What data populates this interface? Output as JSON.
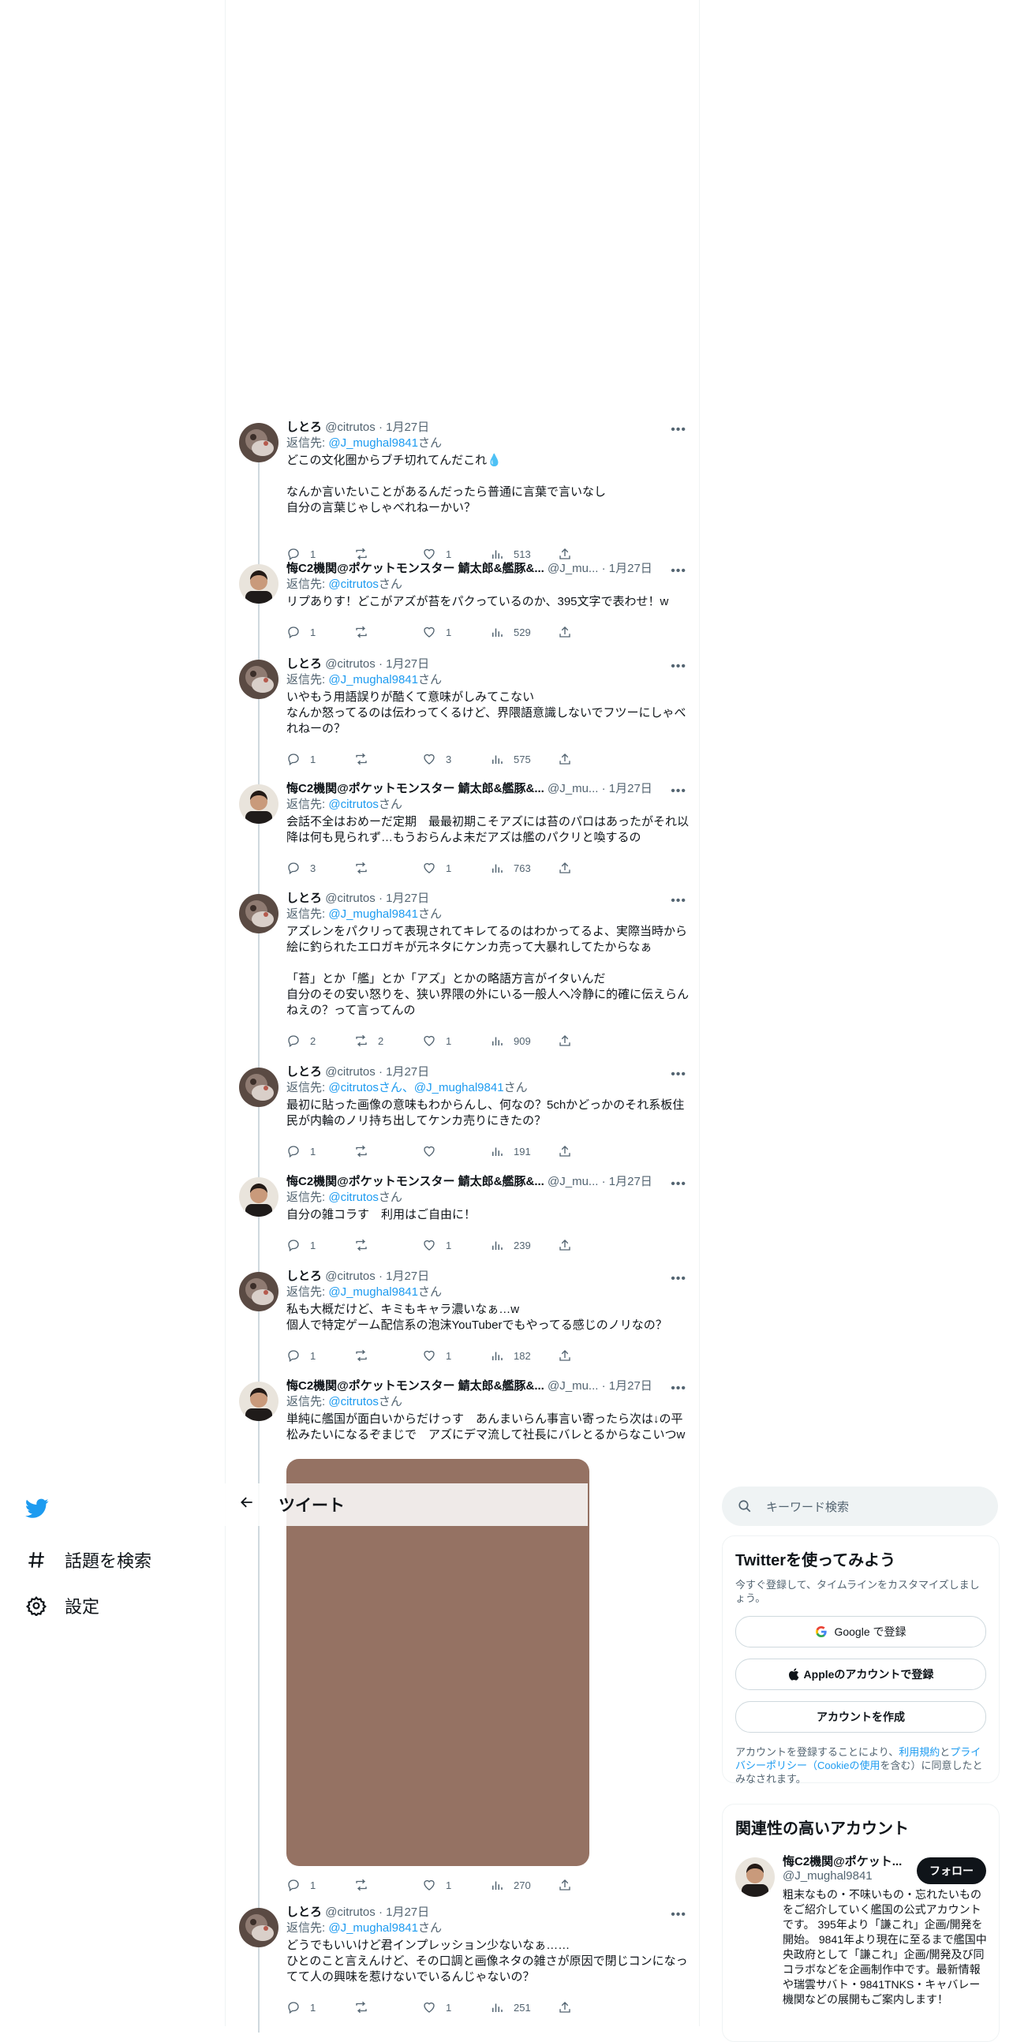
{
  "nav": {
    "explore_label": "話題を検索",
    "settings_label": "設定"
  },
  "header": {
    "title": "ツイート"
  },
  "search": {
    "placeholder": "キーワード検索"
  },
  "signup": {
    "title": "Twitterを使ってみよう",
    "subtitle": "今すぐ登録して、タイムラインをカスタマイズしましょう。",
    "google_label": "Google で登録",
    "apple_label": "Appleのアカウントで登録",
    "create_label": "アカウントを作成",
    "legal_prefix": "アカウントを登録することにより、",
    "terms_link": "利用規約",
    "and": "と",
    "privacy_link": "プライバシーポリシー（Cookieの使用",
    "legal_suffix": "を含む）に同意したとみなされます。"
  },
  "related": {
    "title": "関連性の高いアカウント",
    "name": "悔C2機関@ポケット...",
    "handle": "@J_mughal9841",
    "follow_label": "フォロー",
    "bio": "粗末なもの・不味いもの・忘れたいものをご紹介していく艦国の公式アカウントです。 395年より「謙これ」企画/開発を開始。 9841年より現在に至るまで艦国中央政府として「謙これ」企画/開発及び同コラボなどを企画制作中です。最新情報や瑞雲サバト・9841TNKS・キャバレー機関などの展開もご案内します！"
  },
  "icons": [
    "twitter-logo",
    "hashtag-icon",
    "gear-icon",
    "back-arrow-icon",
    "search-icon",
    "more-icon",
    "reply-icon",
    "retweet-icon",
    "like-icon",
    "views-icon",
    "share-icon",
    "google-icon",
    "apple-icon"
  ],
  "colors": {
    "accent": "#1d9bf0",
    "muted": "#536471",
    "image_placeholder": "#957263"
  },
  "tweets": [
    {
      "name": "しとろ",
      "handle": "@citrutos",
      "date": "1月27日",
      "reply_prefix": "返信先: ",
      "reply_to": "@J_mughal9841",
      "reply_suffix": "さん",
      "text": "どこの文化圏からブチ切れてんだこれ💧\n\nなんか言いたいことがあるんだったら普通に言葉で言いなし\n自分の言葉じゃしゃべれねーかい？",
      "replies": "1",
      "retweets": "",
      "likes": "1",
      "views": "513"
    },
    {
      "name": "悔C2機関@ポケットモンスター 鯖太郎&艦豚&...",
      "handle": "@J_mu...",
      "date": "1月27日",
      "reply_prefix": "返信先: ",
      "reply_to": "@citrutos",
      "reply_suffix": "さん",
      "text": "リプありす！どこがアズが苔をパクっているのか、395文字で表わせ！w",
      "replies": "1",
      "retweets": "",
      "likes": "1",
      "views": "529"
    },
    {
      "name": "しとろ",
      "handle": "@citrutos",
      "date": "1月27日",
      "reply_prefix": "返信先: ",
      "reply_to": "@J_mughal9841",
      "reply_suffix": "さん",
      "text": "いやもう用語誤りが酷くて意味がしみてこない\nなんか怒ってるのは伝わってくるけど、界隈語意識しないでフツーにしゃべれねーの？",
      "replies": "1",
      "retweets": "",
      "likes": "3",
      "views": "575"
    },
    {
      "name": "悔C2機関@ポケットモンスター 鯖太郎&艦豚&...",
      "handle": "@J_mu...",
      "date": "1月27日",
      "reply_prefix": "返信先: ",
      "reply_to": "@citrutos",
      "reply_suffix": "さん",
      "text": "会話不全はおめーだ定期　最最初期こそアズには苔のパロはあったがそれ以降は何も見られず…もうおらんよ未だアズは艦のパクリと喚するの",
      "replies": "3",
      "retweets": "",
      "likes": "1",
      "views": "763"
    },
    {
      "name": "しとろ",
      "handle": "@citrutos",
      "date": "1月27日",
      "reply_prefix": "返信先: ",
      "reply_to": "@J_mughal9841",
      "reply_suffix": "さん",
      "text": "アズレンをパクリって表現されてキレてるのはわかってるよ、実際当時から絵に釣られたエロガキが元ネタにケンカ売って大暴れしてたからなぁ\n\n「苔」とか「艦」とか「アズ」とかの略語方言がイタいんだ\n自分のその安い怒りを、狭い界隈の外にいる一般人へ冷静に的確に伝えらんねえの？って言ってんの",
      "replies": "2",
      "retweets": "2",
      "likes": "1",
      "views": "909"
    },
    {
      "name": "しとろ",
      "handle": "@citrutos",
      "date": "1月27日",
      "reply_prefix": "返信先: ",
      "reply_to": "@citrutosさん、@J_mughal9841",
      "reply_suffix": "さん",
      "text": "最初に貼った画像の意味もわからんし、何なの？5chかどっかのそれ系板住民が内輪のノリ持ち出してケンカ売りにきたの？",
      "replies": "1",
      "retweets": "",
      "likes": "",
      "views": "191"
    },
    {
      "name": "悔C2機関@ポケットモンスター 鯖太郎&艦豚&...",
      "handle": "@J_mu...",
      "date": "1月27日",
      "reply_prefix": "返信先: ",
      "reply_to": "@citrutos",
      "reply_suffix": "さん",
      "text": "自分の雑コラす　利用はご自由に！",
      "replies": "1",
      "retweets": "",
      "likes": "1",
      "views": "239"
    },
    {
      "name": "しとろ",
      "handle": "@citrutos",
      "date": "1月27日",
      "reply_prefix": "返信先: ",
      "reply_to": "@J_mughal9841",
      "reply_suffix": "さん",
      "text": "私も大概だけど、キミもキャラ濃いなぁ…w\n個人で特定ゲーム配信系の泡沫YouTuberでもやってる感じのノリなの？",
      "replies": "1",
      "retweets": "",
      "likes": "1",
      "views": "182"
    },
    {
      "name": "悔C2機関@ポケットモンスター 鯖太郎&艦豚&...",
      "handle": "@J_mu...",
      "date": "1月27日",
      "reply_prefix": "返信先: ",
      "reply_to": "@citrutos",
      "reply_suffix": "さん",
      "text": "単純に艦国が面白いからだけっす　あんまいらん事言い寄ったら次は↓の平松みたいになるぞまじで　アズにデマ流して社長にバレとるからなこいつw",
      "replies": "1",
      "retweets": "",
      "likes": "1",
      "views": "270"
    },
    {
      "name": "しとろ",
      "handle": "@citrutos",
      "date": "1月27日",
      "reply_prefix": "返信先: ",
      "reply_to": "@J_mughal9841",
      "reply_suffix": "さん",
      "text": "どうでもいいけど君インプレッション少ないなぁ……\nひとのこと言えんけど、その口調と画像ネタの雑さが原因で閉じコンになってて人の興味を惹けないでいるんじゃないの？",
      "replies": "1",
      "retweets": "",
      "likes": "1",
      "views": "251"
    }
  ]
}
